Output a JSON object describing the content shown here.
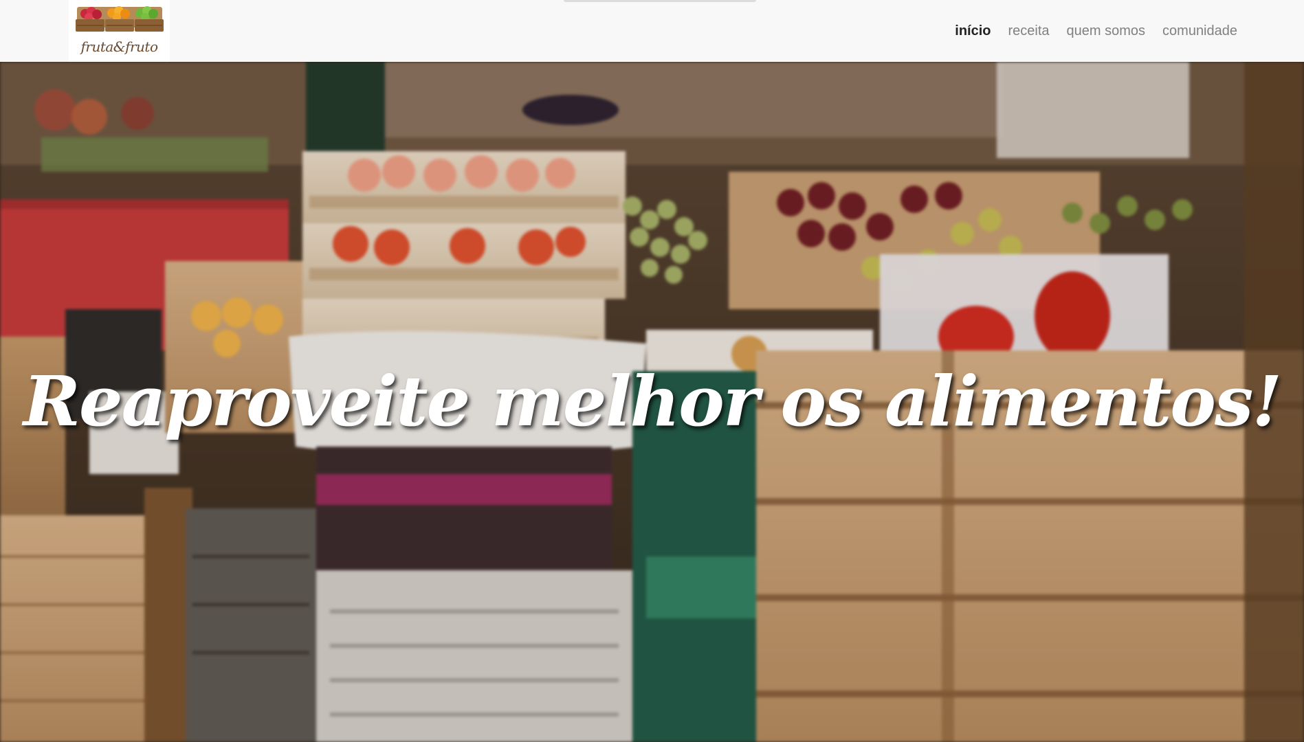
{
  "brand": {
    "logo_text": "fruta&fruto",
    "logo_icon": "fruit-crate-icon"
  },
  "nav": {
    "items": [
      {
        "label": "início",
        "active": true
      },
      {
        "label": "receita",
        "active": false
      },
      {
        "label": "quem somos",
        "active": false
      },
      {
        "label": "comunidade",
        "active": false
      }
    ]
  },
  "hero": {
    "title": "Reaproveite melhor os alimentos!",
    "background": "market-stall-photo"
  },
  "colors": {
    "nav_bg": "#f8f8f8",
    "nav_active": "#222222",
    "nav_inactive": "#808080",
    "hero_title": "#ffffff"
  }
}
